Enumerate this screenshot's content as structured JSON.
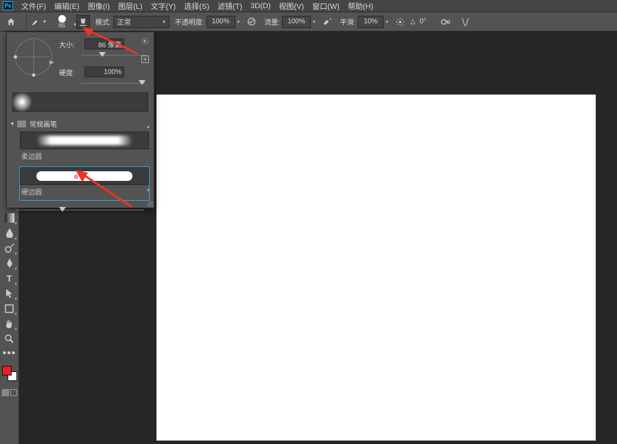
{
  "app": {
    "logo": "Ps"
  },
  "menu": {
    "file": "文件(F)",
    "edit": "编辑(E)",
    "image": "图像(I)",
    "layer": "图层(L)",
    "type": "文字(Y)",
    "select": "选择(S)",
    "filter": "滤镜(T)",
    "threeD": "3D(D)",
    "view": "视图(V)",
    "window": "窗口(W)",
    "help": "帮助(H)"
  },
  "options": {
    "brush_size_display": "86",
    "mode_label": "模式:",
    "mode_value": "正常",
    "opacity_label": "不透明度:",
    "opacity_value": "100%",
    "flow_label": "流量:",
    "flow_value": "100%",
    "smoothing_label": "平滑:",
    "smoothing_value": "10%",
    "angle_icon": "△",
    "angle_value": "0°"
  },
  "brush_popup": {
    "size_label": "大小:",
    "size_value": "86 像素",
    "hardness_label": "硬度:",
    "hardness_value": "100%",
    "group_name": "常规画笔",
    "presets": [
      {
        "label": "柔边圆",
        "kind": "soft",
        "selected": false
      },
      {
        "label": "硬边圆",
        "kind": "hard",
        "selected": true
      }
    ]
  },
  "swatches": {
    "fg": "#ed1c24",
    "bg": "#ffffff"
  }
}
